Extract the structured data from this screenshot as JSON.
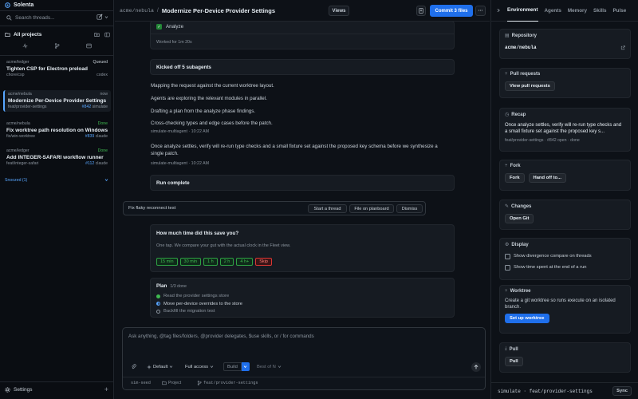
{
  "app": {
    "name": "Solenta"
  },
  "sidebar": {
    "search_placeholder": "Search threads...",
    "projects_label": "All projects",
    "threads": [
      {
        "repo": "acme/ledger",
        "status": "Queued",
        "title": "Tighten CSP for Electron preload",
        "branch": "chore/csp",
        "pr": "",
        "agent": "codex"
      },
      {
        "repo": "acme/nebula",
        "status": "now",
        "title": "Modernize Per-Device Provider Settings",
        "branch": "feat/provider-settings",
        "pr": "#842",
        "agent": "simulate"
      },
      {
        "repo": "acme/nebula",
        "status": "Done",
        "title": "Fix worktree path resolution on Windows",
        "branch": "fix/win-worktree",
        "pr": "#839",
        "agent": "claude"
      },
      {
        "repo": "acme/ledger",
        "status": "Done",
        "title": "Add INTEGER-SAFARI workflow runner",
        "branch": "feat/integer-safari",
        "pr": "#112",
        "agent": "claude"
      }
    ],
    "snoozed_label": "Snoozed (1)",
    "settings_label": "Settings"
  },
  "topbar": {
    "repo": "acme/nebula",
    "separator": "/",
    "title": "Modernize Per-Device Provider Settings",
    "views_label": "Views",
    "commit_label": "Commit 3 files"
  },
  "conversation": {
    "analyze_label": "Analyze",
    "worked_for": "Worked for 1m 20s",
    "subagents_label": "Kicked off 5 subagents",
    "steps": [
      "Mapping the request against the current worktree layout.",
      "Agents are exploring the relevant modules in parallel.",
      "Drafting a plan from the analyze phase findings.",
      "Cross-checking types and edge cases before the patch."
    ],
    "meta1": "simulate-multiagent · 10:22 AM",
    "message": "Once analyze settles, verify will re-run type checks and a small fixture set against the proposed key schema before we synthesize a single patch.",
    "meta2": "simulate-multiagent · 10:22 AM",
    "run_complete": "Run complete",
    "suggestion": {
      "text": "Fix flaky reconnect test",
      "start_label": "Start a thread",
      "planboard_label": "File on planboard",
      "dismiss_label": "Dismiss"
    },
    "survey": {
      "question": "How much time did this save you?",
      "hint": "One tap. We compare your gut with the actual clock in the Fleet view.",
      "options": [
        "15 min",
        "30 min",
        "1 h",
        "2 h",
        "4 h+"
      ],
      "skip_label": "Skip"
    },
    "plan": {
      "title": "Plan",
      "progress": "1/3 done",
      "items": [
        {
          "text": "Read the provider settings store",
          "state": "done"
        },
        {
          "text": "Move per-device overrides to the store",
          "state": "active"
        },
        {
          "text": "Backfill the migration test",
          "state": "todo"
        }
      ]
    }
  },
  "composer": {
    "placeholder": "Ask anything, @tag files/folders, @provider delegates, $use skills, or / for commands",
    "mode": "Default",
    "access": "Full access",
    "action": "Build",
    "best_of": "Best of N",
    "footer": {
      "session": "sim-seed",
      "project": "Project",
      "branch": "feat/provider-settings"
    }
  },
  "right_panel": {
    "tabs": [
      "Environment",
      "Agents",
      "Memory",
      "Skills",
      "Pulse"
    ],
    "active_tab": "Environment",
    "repository": {
      "label": "Repository",
      "value": "acme/nebula"
    },
    "pull_requests": {
      "label": "Pull requests",
      "button": "View pull requests"
    },
    "recap": {
      "label": "Recap",
      "text": "Once analyze settles, verify will re-run type checks and a small fixture set against the proposed key s...",
      "meta": "feat/provider-settings · #842 open · done"
    },
    "fork": {
      "label": "Fork",
      "fork_btn": "Fork",
      "handoff_btn": "Hand off to..."
    },
    "changes": {
      "label": "Changes",
      "button": "Open Git"
    },
    "display": {
      "label": "Display",
      "options": [
        "Show divergence compare on threads",
        "Show time spent at the end of a run"
      ]
    },
    "worktree": {
      "label": "Worktree",
      "text": "Create a git worktree so runs execute on an isolated branch.",
      "button": "Set up worktree"
    },
    "pull": {
      "label": "Pull",
      "button": "Pull"
    },
    "status": {
      "path": "simulate · feat/provider-settings",
      "sync_label": "Sync"
    }
  },
  "colors": {
    "accent": "#1f6feb",
    "done": "#3fb950",
    "skip": "#da3633",
    "bg": "#0d1117"
  }
}
